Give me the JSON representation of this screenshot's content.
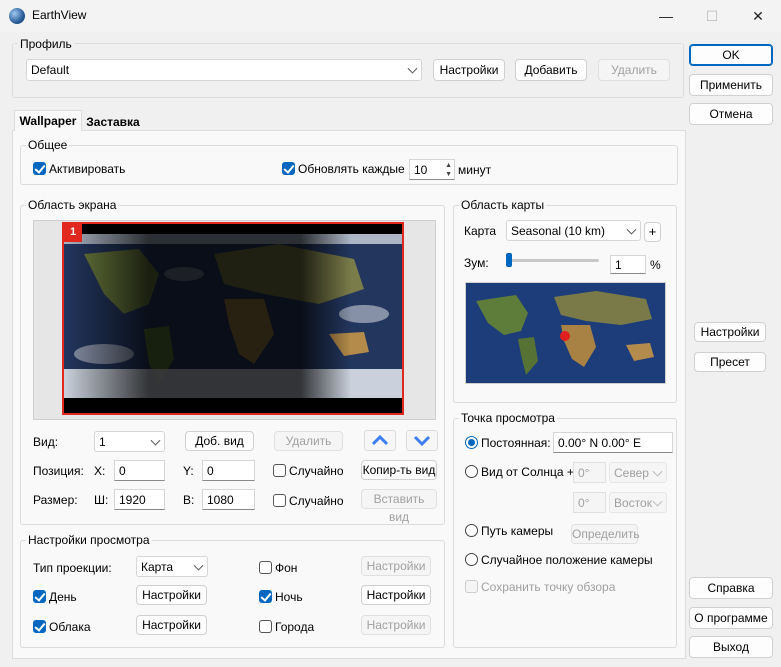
{
  "window": {
    "title": "EarthView",
    "minimize": "—",
    "maximize": "☐",
    "close": "✕"
  },
  "profile": {
    "group_label": "Профиль",
    "selected": "Default",
    "settings_btn": "Настройки",
    "add_btn": "Добавить",
    "delete_btn": "Удалить"
  },
  "right_buttons": {
    "ok": "OK",
    "apply": "Применить",
    "cancel": "Отмена",
    "settings": "Настройки",
    "preset": "Пресет",
    "help": "Справка",
    "about": "О программе",
    "exit": "Выход"
  },
  "tabs": [
    "Wallpaper",
    "Заставка"
  ],
  "general": {
    "label": "Общее",
    "activate": "Активировать",
    "activate_checked": true,
    "update_every": "Обновлять каждые",
    "update_checked": true,
    "interval": "10",
    "minutes": "минут"
  },
  "screen_area": {
    "label": "Область экрана",
    "monitor_number": "1",
    "view_label": "Вид:",
    "view_value": "1",
    "add_view": "Доб. вид",
    "delete": "Удалить",
    "position_label": "Позиция:",
    "x_label": "X:",
    "x_value": "0",
    "y_label": "Y:",
    "y_value": "0",
    "random1": "Случайно",
    "copy_view": "Копир-ть вид",
    "size_label": "Размер:",
    "w_label": "Ш:",
    "w_value": "1920",
    "h_label": "В:",
    "h_value": "1080",
    "random2": "Случайно",
    "paste_view": "Вставить вид"
  },
  "map_area": {
    "label": "Область карты",
    "map_label": "Карта",
    "map_value": "Seasonal (10 km)",
    "plus": "+",
    "zoom_label": "Зум:",
    "zoom_value": "1",
    "percent": "%",
    "zoom_fraction": 0.0
  },
  "viewpoint": {
    "label": "Точка просмотра",
    "fixed": "Постоянная:",
    "fixed_value": "0.00° N  0.00° E",
    "from_sun": "Вид от Солнца +",
    "sun_deg1": "0°",
    "sun_dir1": "Север",
    "sun_deg2": "0°",
    "sun_dir2": "Восток",
    "camera_path": "Путь камеры",
    "define": "Определить",
    "random_camera": "Случайное положение камеры",
    "save_viewpoint": "Сохранить точку обзора"
  },
  "view_settings": {
    "label": "Настройки просмотра",
    "projection_label": "Тип проекции:",
    "projection_value": "Карта",
    "background": "Фон",
    "settings": "Настройки",
    "day": "День",
    "night": "Ночь",
    "clouds": "Облака",
    "cities": "Города"
  }
}
